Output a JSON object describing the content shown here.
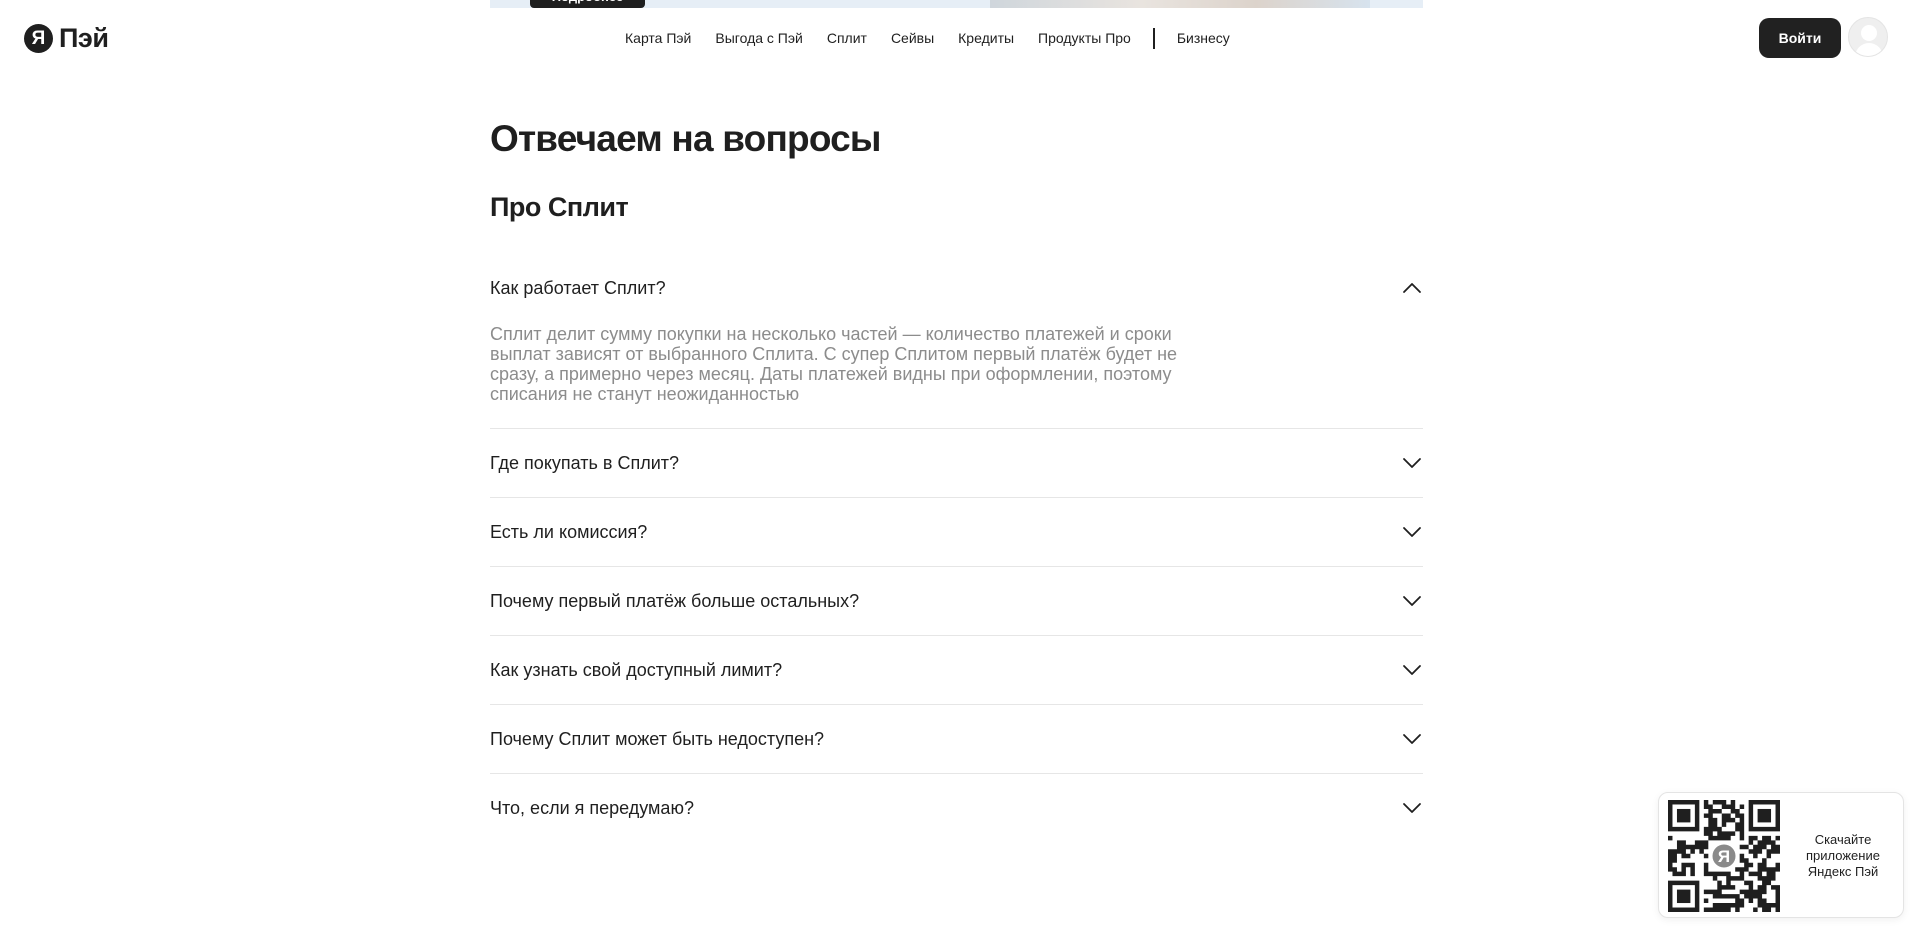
{
  "banner": {
    "button_label": "Подробнее"
  },
  "header": {
    "logo_mark": "Я",
    "logo_text": "Пэй",
    "nav": [
      {
        "label": "Карта Пэй"
      },
      {
        "label": "Выгода с Пэй"
      },
      {
        "label": "Сплит"
      },
      {
        "label": "Сейвы"
      },
      {
        "label": "Кредиты"
      },
      {
        "label": "Продукты Про"
      }
    ],
    "nav_business": "Бизнесу",
    "login_label": "Войти"
  },
  "main": {
    "title": "Отвечаем на вопросы",
    "section_title": "Про Сплит",
    "faq": [
      {
        "question": "Как работает Сплит?",
        "answer": "Сплит делит сумму покупки на несколько частей — количество платежей и сроки выплат зависят от выбранного Сплита. С супер Сплитом первый платёж будет не сразу, а примерно через месяц. Даты платежей видны при оформлении, поэтому списания не станут неожиданностью",
        "open": true,
        "icon": "chevron-up-icon"
      },
      {
        "question": "Где покупать в Сплит?",
        "open": false,
        "icon": "chevron-down-icon"
      },
      {
        "question": "Есть ли комиссия?",
        "open": false,
        "icon": "chevron-down-icon"
      },
      {
        "question": "Почему первый платёж больше остальных?",
        "open": false,
        "icon": "chevron-down-icon"
      },
      {
        "question": "Как узнать свой доступный лимит?",
        "open": false,
        "icon": "chevron-down-icon"
      },
      {
        "question": "Почему Сплит может быть недоступен?",
        "open": false,
        "icon": "chevron-down-icon"
      },
      {
        "question": "Что, если я передумаю?",
        "open": false,
        "icon": "chevron-down-icon"
      }
    ]
  },
  "qr_widget": {
    "text": "Скачайте приложение Яндекс Пэй",
    "center_mark": "Я"
  },
  "colors": {
    "text": "#1f1f1f",
    "muted": "#8c8c8c",
    "divider": "#e6e6e6",
    "button": "#212121"
  }
}
